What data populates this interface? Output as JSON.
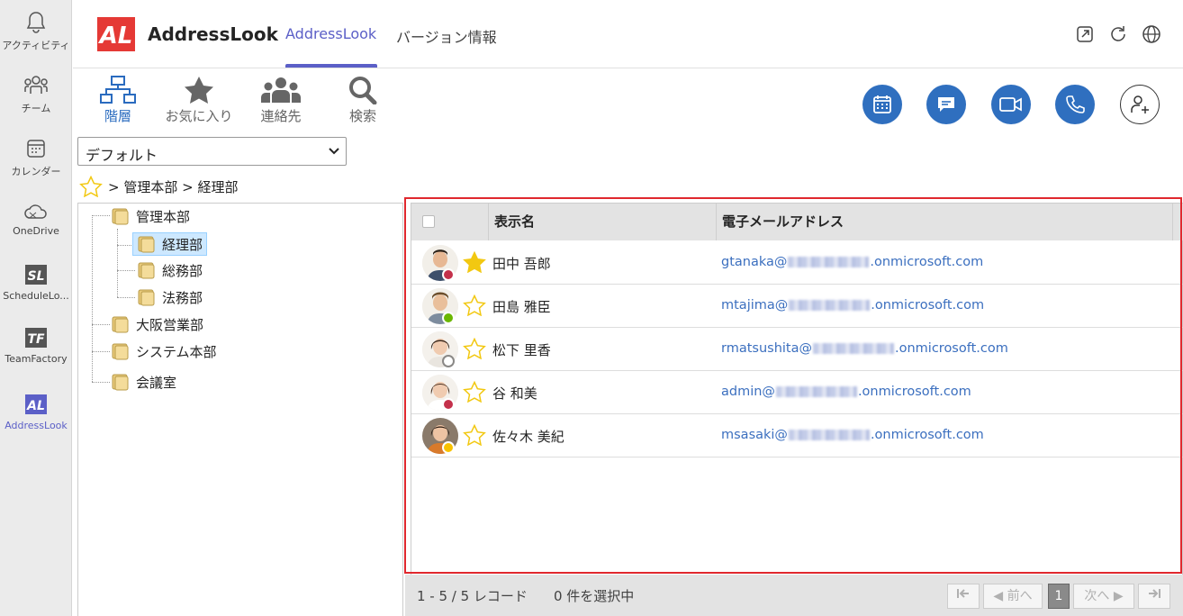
{
  "rail": {
    "items": [
      {
        "label": "アクティビティ",
        "icon": "bell-icon"
      },
      {
        "label": "チーム",
        "icon": "teams-icon"
      },
      {
        "label": "カレンダー",
        "icon": "calendar-icon"
      },
      {
        "label": "OneDrive",
        "icon": "onedrive-icon"
      },
      {
        "label": "ScheduleLo...",
        "icon": "schedulelook-icon"
      },
      {
        "label": "TeamFactory",
        "icon": "teamfactory-icon"
      },
      {
        "label": "AddressLook",
        "icon": "addresslook-icon",
        "active": true
      }
    ]
  },
  "header": {
    "app_name": "AddressLook",
    "tabs": [
      {
        "label": "AddressLook",
        "active": true
      },
      {
        "label": "バージョン情報",
        "active": false
      }
    ]
  },
  "toolbar": {
    "nav": [
      {
        "label": "階層",
        "icon": "hierarchy-icon",
        "active": true
      },
      {
        "label": "お気に入り",
        "icon": "star-icon"
      },
      {
        "label": "連絡先",
        "icon": "contacts-icon"
      },
      {
        "label": "検索",
        "icon": "search-icon"
      }
    ],
    "actions": [
      "calendar-icon",
      "chat-icon",
      "video-icon",
      "phone-icon",
      "add-contact-icon"
    ]
  },
  "filter": {
    "selected": "デフォルト"
  },
  "breadcrumb": {
    "path": "> 管理本部 > 経理部"
  },
  "tree": {
    "nodes": [
      {
        "label": "管理本部",
        "level": 0
      },
      {
        "label": "経理部",
        "level": 1,
        "selected": true
      },
      {
        "label": "総務部",
        "level": 1
      },
      {
        "label": "法務部",
        "level": 1
      },
      {
        "label": "大阪営業部",
        "level": 0
      },
      {
        "label": "システム本部",
        "level": 0
      },
      {
        "label": "会議室",
        "level": 0
      }
    ]
  },
  "grid": {
    "columns": [
      "表示名",
      "電子メールアドレス"
    ],
    "rows": [
      {
        "name": "田中 吾郎",
        "email_local": "gtanaka@",
        "email_domain": ".onmicrosoft.com",
        "favorite": true,
        "presence": "busy",
        "presence_color": "#c4314b"
      },
      {
        "name": "田島 雅臣",
        "email_local": "mtajima@",
        "email_domain": ".onmicrosoft.com",
        "favorite": false,
        "presence": "available",
        "presence_color": "#6bb700"
      },
      {
        "name": "松下 里香",
        "email_local": "rmatsushita@",
        "email_domain": ".onmicrosoft.com",
        "favorite": false,
        "presence": "offline",
        "presence_color": "#8a8886"
      },
      {
        "name": "谷 和美",
        "email_local": "admin@",
        "email_domain": ".onmicrosoft.com",
        "favorite": false,
        "presence": "busy",
        "presence_color": "#c4314b"
      },
      {
        "name": "佐々木 美紀",
        "email_local": "msasaki@",
        "email_domain": ".onmicrosoft.com",
        "favorite": false,
        "presence": "away",
        "presence_color": "#f8c200"
      }
    ]
  },
  "footer": {
    "record_count": "1 - 5 / 5 レコード",
    "selected_count": "0 件を選択中",
    "prev_label": "前へ",
    "next_label": "次へ",
    "current_page": "1"
  },
  "colors": {
    "accent": "#5b5fc7",
    "action_blue": "#2f6fbf",
    "highlight_red": "#e0282e"
  }
}
